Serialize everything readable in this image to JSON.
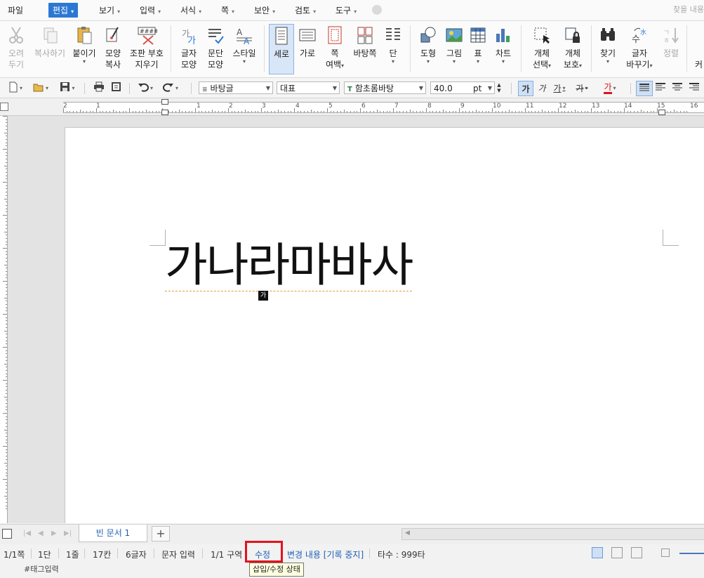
{
  "menubar": {
    "items": [
      {
        "label": "파일",
        "arrow": ""
      },
      {
        "label": "편집",
        "arrow": "▾"
      },
      {
        "label": "보기",
        "arrow": "▾"
      },
      {
        "label": "입력",
        "arrow": "▾"
      },
      {
        "label": "서식",
        "arrow": "▾"
      },
      {
        "label": "쪽",
        "arrow": "▾"
      },
      {
        "label": "보안",
        "arrow": "▾"
      },
      {
        "label": "검토",
        "arrow": "▾"
      },
      {
        "label": "도구",
        "arrow": "▾"
      }
    ],
    "search_placeholder": "찾을 내용"
  },
  "ribbon": {
    "cut": {
      "line1": "오려",
      "line2": "두기"
    },
    "copy": {
      "line1": "복사하기"
    },
    "paste": {
      "line1": "붙이기"
    },
    "format_copy": {
      "line1": "모양",
      "line2": "복사"
    },
    "erase_marks": {
      "line1": "조판 부호",
      "line2": "지우기"
    },
    "char_shape": {
      "line1": "글자",
      "line2": "모양"
    },
    "para_shape": {
      "line1": "문단",
      "line2": "모양"
    },
    "style": {
      "line1": "스타일"
    },
    "portrait": {
      "line1": "세로"
    },
    "landscape": {
      "line1": "가로"
    },
    "margins": {
      "line1": "쪽",
      "line2": "여백"
    },
    "background": {
      "line1": "바탕쪽"
    },
    "columns": {
      "line1": "단"
    },
    "shape": {
      "line1": "도형"
    },
    "picture": {
      "line1": "그림"
    },
    "table": {
      "line1": "표"
    },
    "chart": {
      "line1": "차트"
    },
    "select_obj": {
      "line1": "개체",
      "line2": "선택"
    },
    "protect_obj": {
      "line1": "개체",
      "line2": "보호"
    },
    "find": {
      "line1": "찾기"
    },
    "replace": {
      "line1": "글자",
      "line2": "바꾸기"
    },
    "sort": {
      "line1": "정렬"
    },
    "more": {
      "line1": "커"
    }
  },
  "format_bar": {
    "style_name": "바탕글",
    "lang": "대표",
    "font": "함초롬바탕",
    "font_size": "40.0",
    "size_unit": "pt",
    "bold_glyph": "가",
    "italic_glyph": "가",
    "underline_glyph": "가",
    "strike_glyph": "가",
    "color_glyph": "가"
  },
  "ruler": {
    "numbers": [
      "2",
      "1",
      "1",
      "2",
      "3",
      "4",
      "5",
      "6",
      "7",
      "8",
      "9",
      "10",
      "11",
      "12",
      "13",
      "14",
      "15",
      "16"
    ]
  },
  "document": {
    "text": "가나라마바사",
    "ime_indicator": "가"
  },
  "tabbar": {
    "tab_label": "빈 문서 1",
    "add_label": "+"
  },
  "statusbar": {
    "page": "1/1쪽",
    "column": "1단",
    "line": "1줄",
    "col_pos": "17칸",
    "chars": "6글자",
    "input_mode": "문자 입력",
    "section": "1/1 구역",
    "edit_mode": "수정",
    "track_changes": "변경 내용 [기록 중지]",
    "typing_speed": "타수 : 999타"
  },
  "tooltip": {
    "text": "삽입/수정 상태"
  },
  "tagline": {
    "text": "#태그입력"
  },
  "colors": {
    "accent": "#2b78d4",
    "highlight_red": "#e0141e",
    "link_blue": "#1f5fb7"
  }
}
